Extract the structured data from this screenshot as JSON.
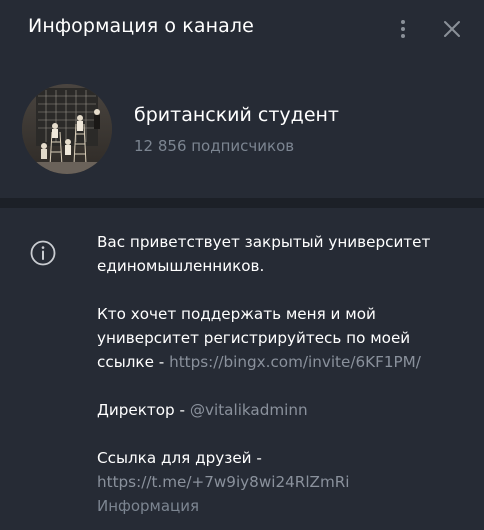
{
  "header": {
    "title": "Информация о канале",
    "more_icon": "more-vertical-icon",
    "close_icon": "close-icon"
  },
  "channel": {
    "name": "британский студент",
    "subscribers": "12 856 подписчиков"
  },
  "info": {
    "icon": "info-icon",
    "paragraph1": {
      "line1": "Вас приветствует закрытый университет",
      "line2": "единомышленников."
    },
    "paragraph2": {
      "line1": "Кто хочет поддержать меня и мой",
      "line2": "университет регистрируйтесь по моей",
      "line3_prefix": "ссылке - ",
      "link": "https://bingx.com/invite/6KF1PM/"
    },
    "paragraph3": {
      "prefix": "Директор - ",
      "mention": "@vitalikadminn"
    },
    "paragraph4": {
      "line1": "Ссылка для друзей -",
      "link": "https://t.me/+7w9iy8wi24RlZmRi"
    },
    "label": "Информация"
  },
  "colors": {
    "background": "#262b35",
    "divider": "#1c2027",
    "secondary_text": "#7c8591",
    "link": "#8a919c"
  }
}
